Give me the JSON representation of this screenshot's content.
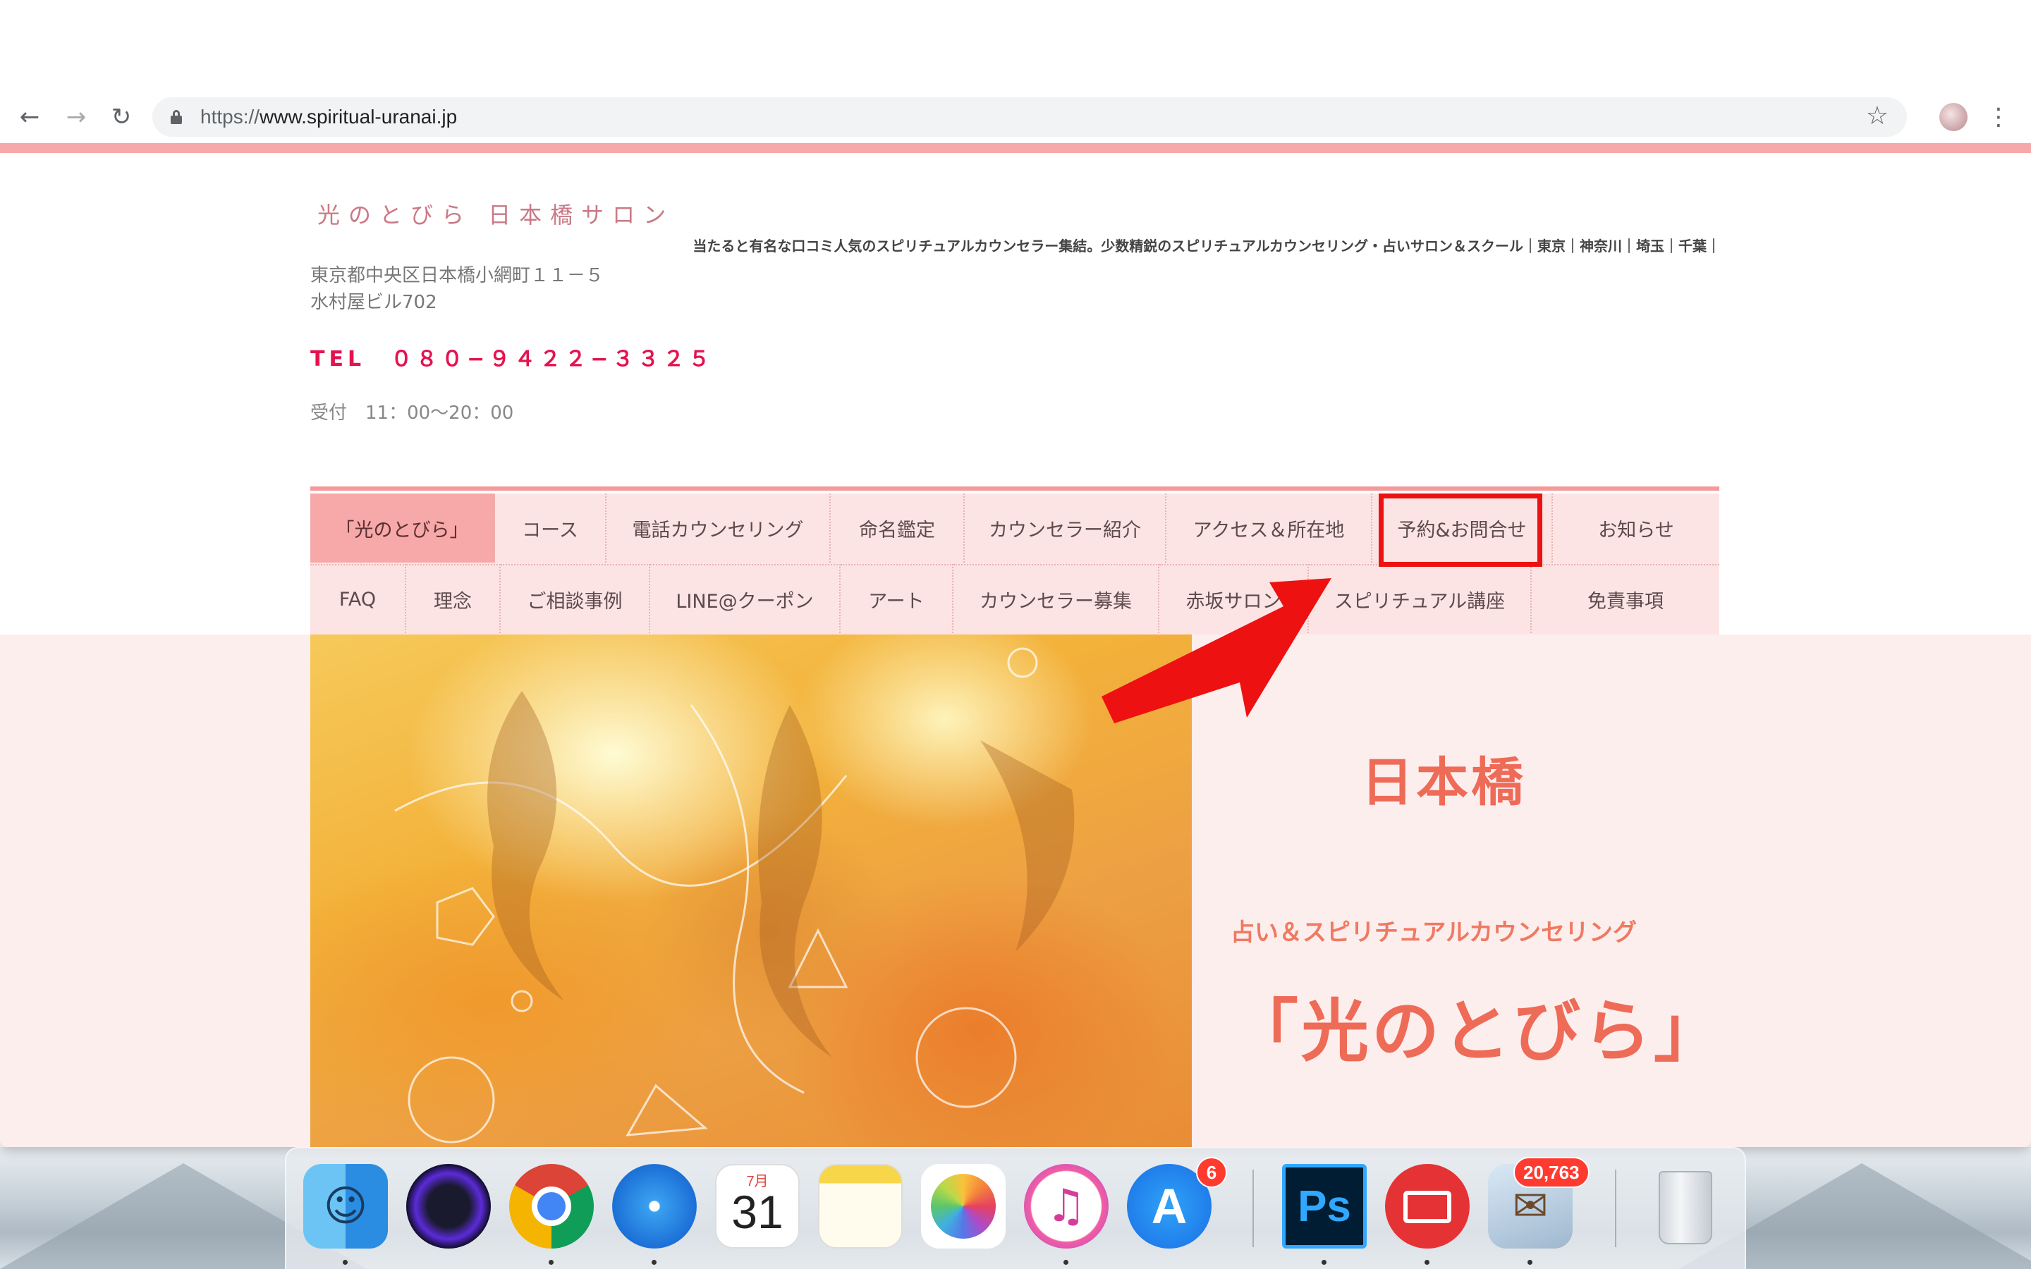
{
  "browser": {
    "url_scheme": "https://",
    "url_host": "www.spiritual-uranai.jp",
    "back_icon": "arrow-left-icon",
    "forward_icon": "arrow-right-icon",
    "reload_icon": "reload-icon",
    "bookmark_icon": "star-icon",
    "menu_icon": "kebab-menu-icon"
  },
  "site": {
    "logo": "光のとびら 日本橋サロン",
    "tagline": "当たると有名な口コミ人気のスピリチュアルカウンセラー集結。少数精鋭のスピリチュアルカウンセリング・占いサロン＆スクール｜東京｜神奈川｜埼玉｜千葉｜",
    "address_line1": "東京都中央区日本橋小網町１１－５",
    "address_line2": "水村屋ビル702",
    "phone": "TEL　０８０−９４２２−３３２５",
    "hours": "受付　11：00〜20：00"
  },
  "nav": {
    "row1": [
      {
        "label": "「光のとびら」",
        "active": true
      },
      {
        "label": "コース"
      },
      {
        "label": "電話カウンセリング"
      },
      {
        "label": "命名鑑定"
      },
      {
        "label": "カウンセラー紹介"
      },
      {
        "label": "アクセス＆所在地"
      },
      {
        "label": "予約&お問合せ",
        "highlighted": true
      },
      {
        "label": "お知らせ"
      }
    ],
    "row2": [
      {
        "label": "FAQ"
      },
      {
        "label": "理念"
      },
      {
        "label": "ご相談事例"
      },
      {
        "label": "LINE@クーポン"
      },
      {
        "label": "アート"
      },
      {
        "label": "カウンセラー募集"
      },
      {
        "label": "赤坂サロン"
      },
      {
        "label": "スピリチュアル講座"
      },
      {
        "label": "免責事項"
      }
    ]
  },
  "hero": {
    "place": "日本橋",
    "subtitle": "占い＆スピリチュアルカウンセリング",
    "title": "「光のとびら」"
  },
  "annotation": {
    "highlight_color": "#ee1111",
    "arrow_color": "#ee1111"
  },
  "dock": {
    "calendar_month": "7月",
    "calendar_day": "31",
    "appstore_badge": "6",
    "mail_badge": "20,763",
    "apps": [
      "finder-icon",
      "siri-icon",
      "chrome-icon",
      "safari-icon",
      "calendar-icon",
      "notes-icon",
      "photos-icon",
      "itunes-icon",
      "app-store-icon",
      "photoshop-icon",
      "mail-client-icon",
      "mail-app-icon",
      "trash-icon"
    ]
  },
  "colors": {
    "brand_pink": "#f7a8a8",
    "nav_bg": "#fde4e4",
    "phone_red": "#e4134d",
    "hero_text": "#ee6b57"
  }
}
